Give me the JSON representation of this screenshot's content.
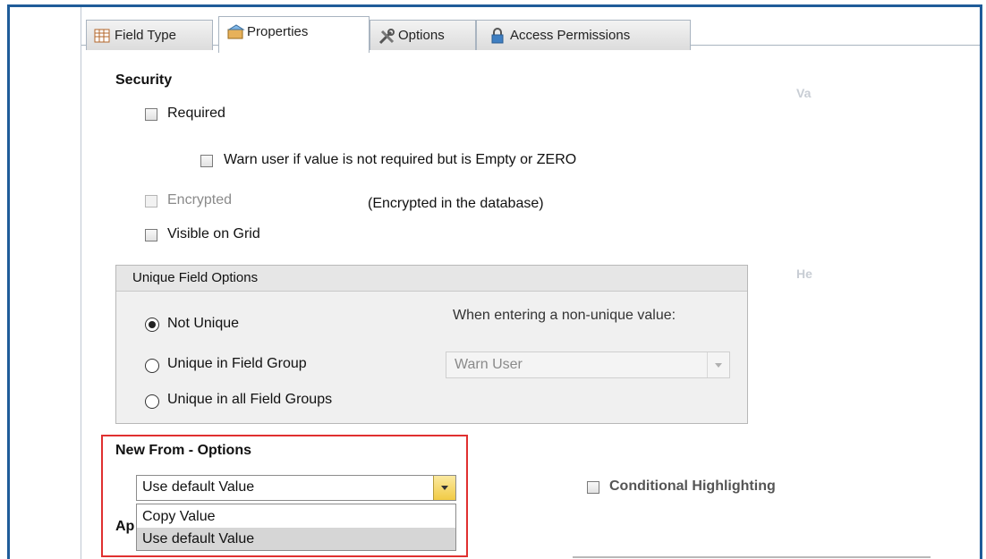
{
  "tabs": [
    {
      "label": "Field Type",
      "icon": "table-icon"
    },
    {
      "label": "Properties",
      "icon": "properties-icon"
    },
    {
      "label": "Options",
      "icon": "tools-icon"
    },
    {
      "label": "Access Permissions",
      "icon": "lock-icon"
    }
  ],
  "active_tab": "Properties",
  "security": {
    "title": "Security",
    "required_label": "Required",
    "warn_label": "Warn user if value is not required but is Empty or ZERO",
    "encrypted_label": "Encrypted",
    "encrypted_note": "(Encrypted in the database)",
    "visible_on_grid_label": "Visible on Grid"
  },
  "unique_field_options": {
    "title": "Unique Field Options",
    "options": [
      "Not Unique",
      "Unique in Field Group",
      "Unique in all Field Groups"
    ],
    "selected": "Not Unique",
    "non_unique_label": "When entering a non-unique value:",
    "non_unique_value": "Warn User"
  },
  "new_from": {
    "title": "New From - Options",
    "selected_value": "Use default Value",
    "options": [
      "Copy Value",
      "Use default Value"
    ]
  },
  "conditional_highlighting_label": "Conditional Highlighting",
  "clipped_labels": {
    "right_top": "Va",
    "right_mid": "He",
    "below_new_from": "Ap"
  },
  "colors": {
    "frame_border": "#1f5c99",
    "highlight_border": "#e03030",
    "dropdown_button": "#f1cb45"
  }
}
